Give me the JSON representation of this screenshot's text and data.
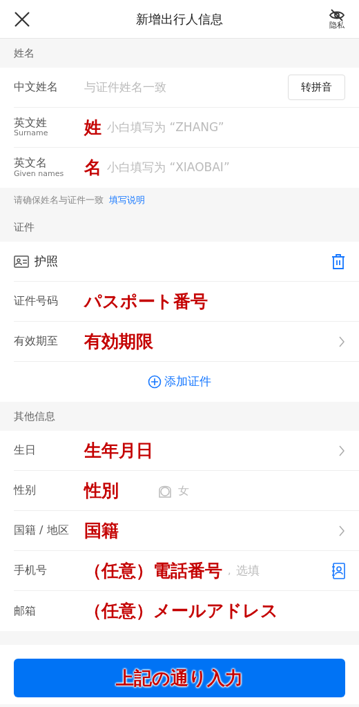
{
  "header": {
    "title": "新增出行人信息",
    "privacy_label": "隐私"
  },
  "sections": [
    {
      "title": "姓名",
      "rows": [
        {
          "kind": "input",
          "label": "中文姓名",
          "placeholder": "与证件姓名一致",
          "button": "转拼音"
        },
        {
          "kind": "input",
          "label": "英文姓",
          "sublabel": "Surname",
          "annotation": "姓",
          "placeholder": "小白填写为 “ZHANG”"
        },
        {
          "kind": "input",
          "label": "英文名",
          "sublabel": "Given names",
          "annotation": "名",
          "placeholder": "小白填写为 “XIAOBAI”"
        }
      ],
      "note": {
        "text": "请确保姓名与证件一致",
        "link": "填写说明"
      }
    },
    {
      "title": "证件",
      "rows": [
        {
          "kind": "document",
          "label": "护照",
          "deletable": true
        },
        {
          "kind": "input",
          "label": "证件号码",
          "annotation": "パスポート番号"
        },
        {
          "kind": "input",
          "label": "有效期至",
          "annotation": "有効期限",
          "chevron": true
        },
        {
          "kind": "add",
          "label": "添加证件"
        }
      ]
    },
    {
      "title": "其他信息",
      "rows": [
        {
          "kind": "input",
          "label": "生日",
          "annotation": "生年月日",
          "chevron": true
        },
        {
          "kind": "gender",
          "label": "性别",
          "annotation": "性別",
          "option": "女"
        },
        {
          "kind": "input",
          "label": "国籍 / 地区",
          "annotation": "国籍",
          "chevron": true
        },
        {
          "kind": "input",
          "label": "手机号",
          "annotation": "（任意）電話番号",
          "separator": ",",
          "placeholder": "选填",
          "contacts_picker": true
        },
        {
          "kind": "input",
          "label": "邮箱",
          "annotation": "（任意）メールアドレス"
        }
      ]
    }
  ],
  "submit": {
    "annotation": "上記の通り入力"
  }
}
